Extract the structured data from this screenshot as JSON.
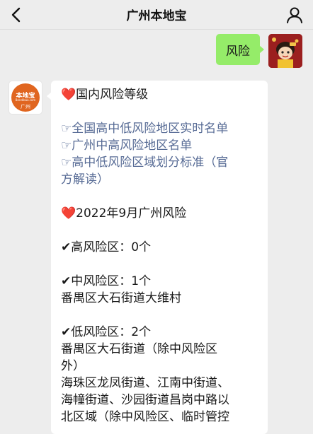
{
  "header": {
    "title": "广州本地宝"
  },
  "outgoing": {
    "text": "风险"
  },
  "bot": {
    "logo_text": "本地宝",
    "logo_sub": "Bendibao.com",
    "logo_city": "广州"
  },
  "message": {
    "heading1_icon": "❤️",
    "heading1": "国内风险等级",
    "links": [
      "☞全国高中低风险地区实时名单",
      "☞广州中高风险地区名单",
      "☞高中低风险区域划分标准（官",
      "方解读）"
    ],
    "heading2_icon": "❤️",
    "heading2": "2022年9月广州风险",
    "check_icon": "✔",
    "high": "高风险区：0个",
    "mid": "中风险区：1个",
    "mid_detail": "番禺区大石街道大维村",
    "low": "低风险区：2个",
    "low_detail_lines": [
      "番禺区大石街道（除中风险区",
      "外）",
      "海珠区龙凤街道、江南中街道、",
      "海幢街道、沙园街道昌岗中路以",
      "北区域（除中风险区、临时管控"
    ]
  }
}
